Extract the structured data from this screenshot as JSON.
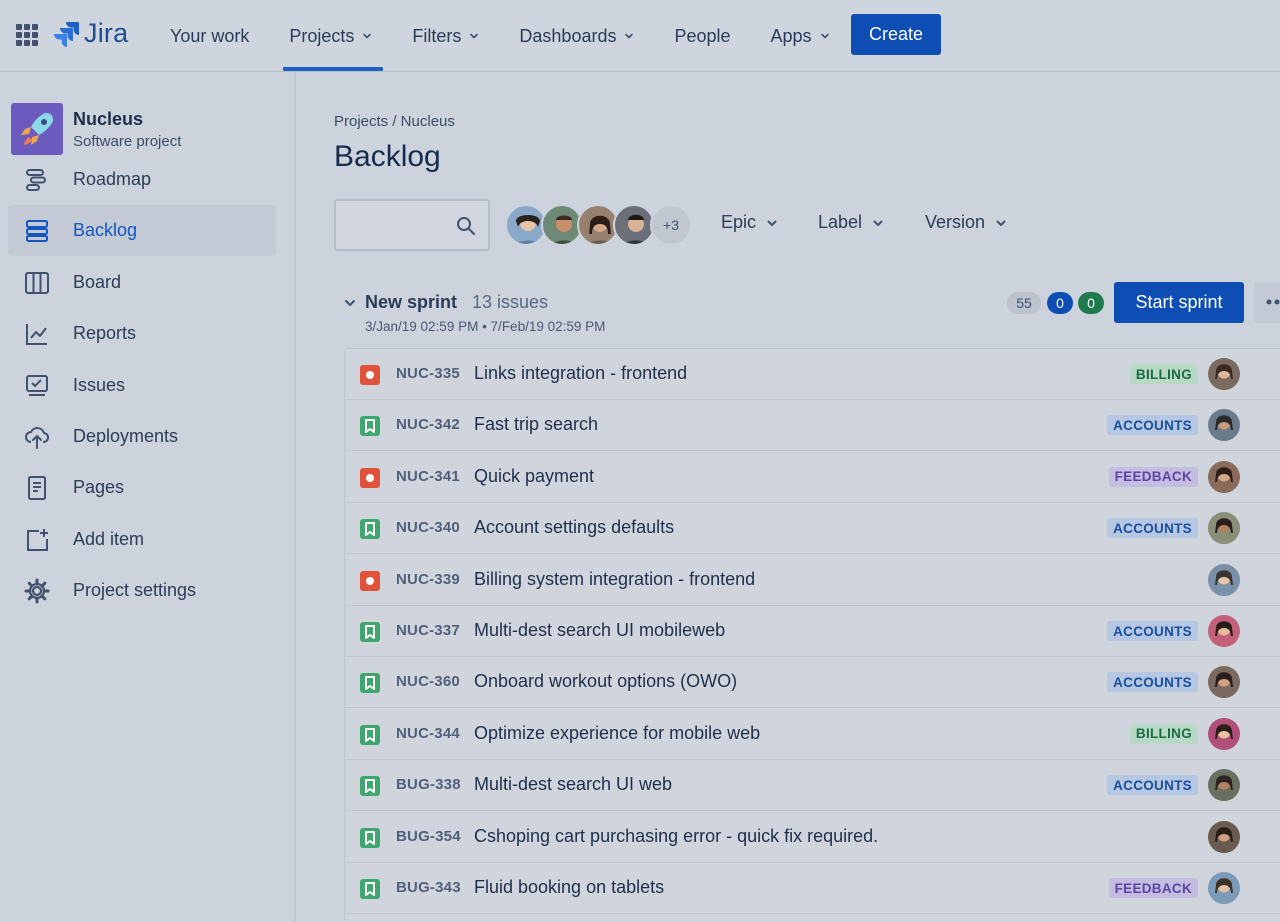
{
  "topnav": {
    "logo_text": "Jira",
    "items": [
      {
        "label": "Your work",
        "has_chevron": false
      },
      {
        "label": "Projects",
        "has_chevron": true
      },
      {
        "label": "Filters",
        "has_chevron": true
      },
      {
        "label": "Dashboards",
        "has_chevron": true
      },
      {
        "label": "People",
        "has_chevron": false
      },
      {
        "label": "Apps",
        "has_chevron": true
      }
    ],
    "active_item": "Projects",
    "create_label": "Create"
  },
  "project": {
    "name": "Nucleus",
    "type": "Software project"
  },
  "sidebar": {
    "items": [
      {
        "label": "Roadmap",
        "icon": "roadmap-icon"
      },
      {
        "label": "Backlog",
        "icon": "backlog-icon",
        "active": true
      },
      {
        "label": "Board",
        "icon": "board-icon"
      },
      {
        "label": "Reports",
        "icon": "reports-icon"
      },
      {
        "label": "Issues",
        "icon": "issues-icon"
      },
      {
        "label": "Deployments",
        "icon": "cloud-upload-icon"
      },
      {
        "label": "Pages",
        "icon": "page-icon"
      },
      {
        "label": "Add item",
        "icon": "add-item-icon"
      },
      {
        "label": "Project settings",
        "icon": "gear-icon"
      }
    ]
  },
  "main": {
    "breadcrumb": "Projects / Nucleus",
    "title": "Backlog",
    "search": {
      "placeholder": "",
      "value": ""
    },
    "avatar_more": "+3",
    "filters": [
      "Epic",
      "Label",
      "Version"
    ]
  },
  "sprint": {
    "name": "New sprint",
    "count": "13 issues",
    "dates": "3/Jan/19 02:59 PM • 7/Feb/19 02:59 PM",
    "pills": [
      "55",
      "0",
      "0"
    ],
    "start_label": "Start sprint"
  },
  "colors": {
    "brand": "#0e4db3",
    "bug": "#e0533a",
    "story": "#3fa66e",
    "billing_bg": "#b7d9c6",
    "billing_fg": "#1c6b42",
    "accounts_bg": "#b5c7e3",
    "accounts_fg": "#1a4f9c",
    "feedback_bg": "#c5bde0",
    "feedback_fg": "#5a45a6"
  },
  "issues": [
    {
      "key": "NUC-335",
      "summary": "Links integration - frontend",
      "type": "bug",
      "label": "BILLING"
    },
    {
      "key": "NUC-342",
      "summary": "Fast trip search",
      "type": "story",
      "label": "ACCOUNTS"
    },
    {
      "key": "NUC-341",
      "summary": "Quick payment",
      "type": "bug",
      "label": "FEEDBACK"
    },
    {
      "key": "NUC-340",
      "summary": "Account settings defaults",
      "type": "story",
      "label": "ACCOUNTS"
    },
    {
      "key": "NUC-339",
      "summary": "Billing system integration - frontend",
      "type": "bug",
      "label": ""
    },
    {
      "key": "NUC-337",
      "summary": "Multi-dest search UI mobileweb",
      "type": "story",
      "label": "ACCOUNTS"
    },
    {
      "key": "NUC-360",
      "summary": "Onboard workout options (OWO)",
      "type": "story",
      "label": "ACCOUNTS"
    },
    {
      "key": "NUC-344",
      "summary": "Optimize experience for mobile web",
      "type": "story",
      "label": "BILLING"
    },
    {
      "key": "BUG-338",
      "summary": "Multi-dest search UI web",
      "type": "story",
      "label": "ACCOUNTS"
    },
    {
      "key": "BUG-354",
      "summary": "Cshoping cart purchasing error - quick fix required.",
      "type": "story",
      "label": ""
    },
    {
      "key": "BUG-343",
      "summary": "Fluid booking on tablets",
      "type": "story",
      "label": "FEEDBACK"
    }
  ]
}
